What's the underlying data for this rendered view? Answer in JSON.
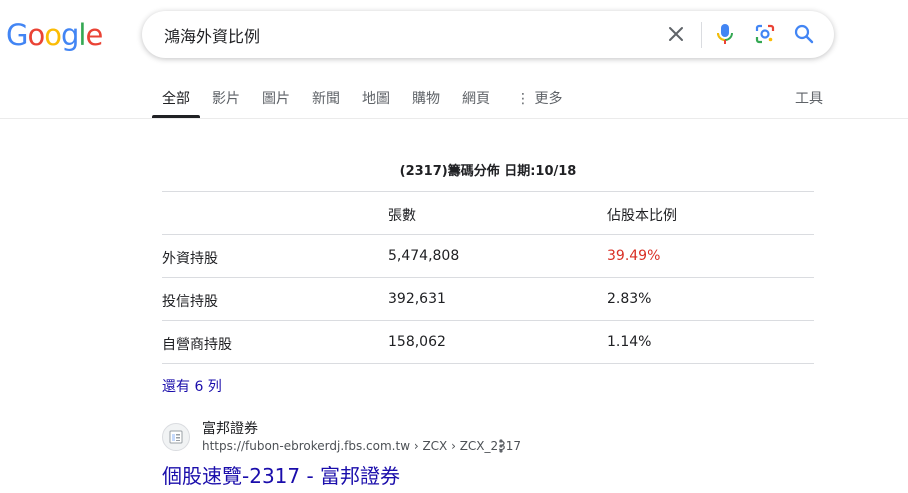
{
  "logo": {
    "letters": [
      "G",
      "o",
      "o",
      "g",
      "l",
      "e"
    ],
    "colors": [
      "#4285F4",
      "#EA4335",
      "#FBBC05",
      "#4285F4",
      "#34A853",
      "#EA4335"
    ]
  },
  "search": {
    "query": "鴻海外資比例",
    "clear_icon": "close-icon",
    "voice_icon": "microphone-icon",
    "lens_icon": "lens-icon",
    "search_icon": "search-icon"
  },
  "tabs": {
    "all": "全部",
    "videos": "影片",
    "images": "圖片",
    "news": "新聞",
    "maps": "地圖",
    "shopping": "購物",
    "web": "網頁",
    "more": "⋮ 更多",
    "tools": "工具"
  },
  "table": {
    "title": "(2317)籌碼分佈 日期:10/18",
    "headers": [
      "",
      "張數",
      "佔股本比例"
    ],
    "rows": [
      {
        "label": "外資持股",
        "shares": "5,474,808",
        "ratio": "39.49%"
      },
      {
        "label": "投信持股",
        "shares": "392,631",
        "ratio": "2.83%"
      },
      {
        "label": "自營商持股",
        "shares": "158,062",
        "ratio": "1.14%"
      }
    ],
    "more_rows": "還有 6 列"
  },
  "result": {
    "site_name": "富邦證券",
    "url": "https://fubon-ebrokerdj.fbs.com.tw › ZCX › ZCX_2317",
    "title": "個股速覽-2317 - 富邦證券"
  },
  "colors": {
    "link": "#1a0dab",
    "highlight_red": "#d93025"
  }
}
